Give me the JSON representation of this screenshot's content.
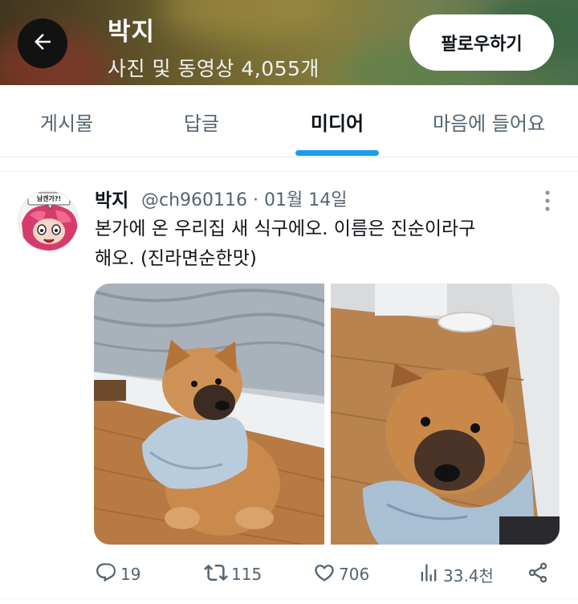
{
  "header": {
    "name": "박지",
    "subtitle": "사진 및 동영상 4,055개",
    "follow_label": "팔로우하기",
    "back_icon": "arrow-left-icon"
  },
  "tabs": [
    {
      "label": "게시물",
      "active": false
    },
    {
      "label": "답글",
      "active": false
    },
    {
      "label": "미디어",
      "active": true
    },
    {
      "label": "마음에 들어요",
      "active": false
    }
  ],
  "accent_color": "#1d9bf0",
  "tweet": {
    "author_name": "박지",
    "meta": "@ch960116 · 01월 14일",
    "text_line1": "본가에 온 우리집 새 식구에오. 이름은 진순이라구",
    "text_line2": "해오. (진라면순한맛)",
    "avatar_text": "남겐가?!",
    "actions": {
      "replies": "19",
      "retweets": "115",
      "likes": "706",
      "views": "33.4천"
    }
  }
}
